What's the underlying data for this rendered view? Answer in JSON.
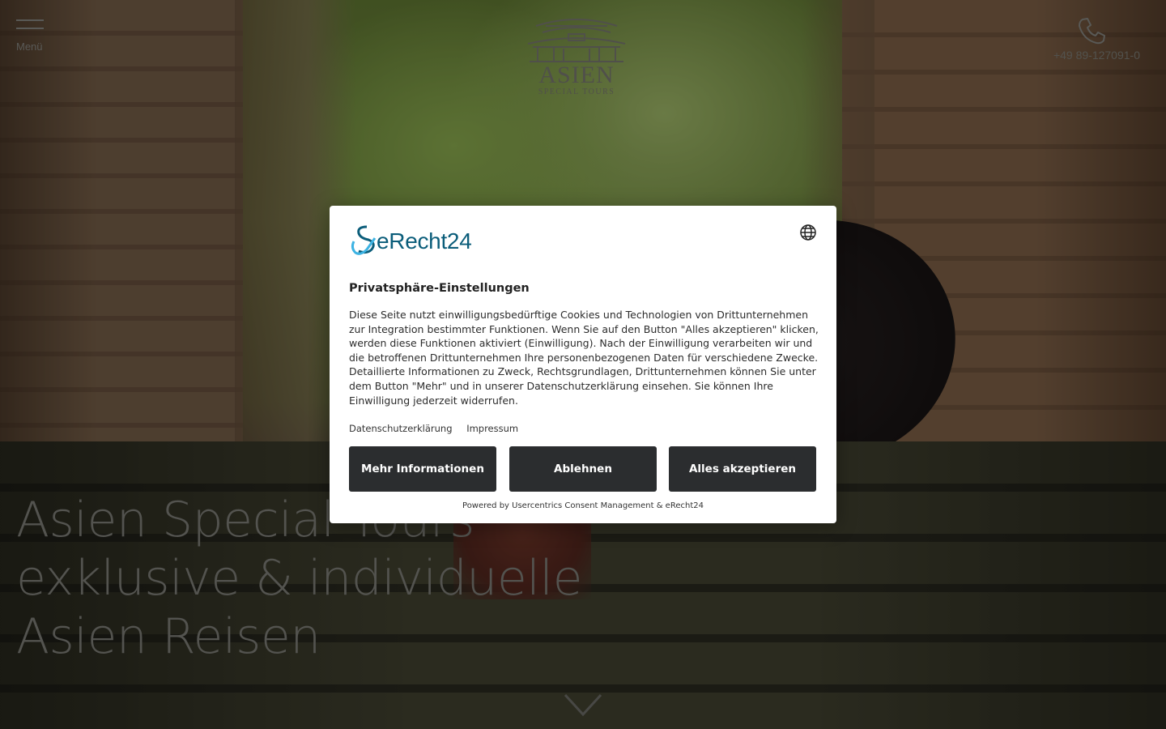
{
  "header": {
    "menu_label": "Menü",
    "logo_title": "ASIEN",
    "logo_subtitle": "SPECIAL TOURS",
    "phone_number": "+49 89-127091-0"
  },
  "hero": {
    "headline_lines": [
      "Asien Special Tours",
      "exklusive & individuelle",
      "Asien Reisen"
    ]
  },
  "consent": {
    "brand_name": "eRecht24",
    "title": "Privatsphäre-Einstellungen",
    "body": "Diese Seite nutzt einwilligungsbedürftige Cookies und Technologien von Drittunternehmen zur Integration bestimmter Funktionen. Wenn Sie auf den Button \"Alles akzeptieren\" klicken, werden diese Funktionen aktiviert (Einwilligung). Nach der Einwilligung verarbeiten wir und die betroffenen Drittunternehmen Ihre personenbezogenen Daten für verschiedene Zwecke. Detaillierte Informationen zu Zweck, Rechtsgrundlagen, Drittunternehmen können Sie unter dem Button \"Mehr\" und in unserer Datenschutzerklärung einsehen. Sie können Ihre Einwilligung jederzeit widerrufen.",
    "links": {
      "privacy": "Datenschutzerklärung",
      "imprint": "Impressum"
    },
    "buttons": {
      "more": "Mehr Informationen",
      "reject": "Ablehnen",
      "accept": "Alles akzeptieren"
    },
    "powered_by": "Powered by Usercentrics Consent Management & eRecht24"
  },
  "colors": {
    "brand_teal": "#0b5d7a",
    "button_dark": "#2b2d2f",
    "header_gray": "#9a9a94"
  },
  "icons": [
    "hamburger-icon",
    "temple-gate-icon",
    "phone-icon",
    "globe-icon",
    "chevron-down-icon",
    "erecht24-logo-icon"
  ]
}
